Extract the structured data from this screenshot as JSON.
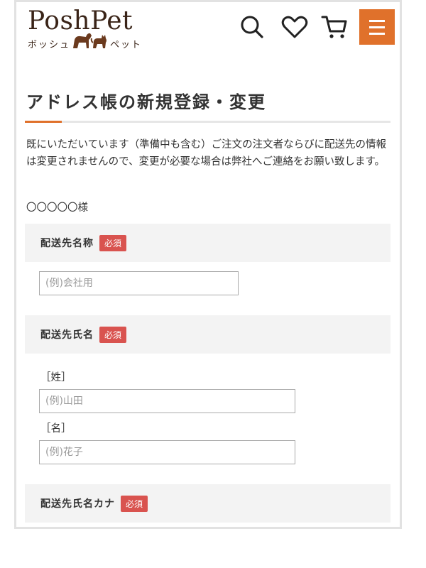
{
  "header": {
    "logo_main": "PoshPet",
    "logo_sub_left": "ボッシュ",
    "logo_sub_right": "ペット",
    "icons": [
      "search-icon",
      "heart-icon",
      "cart-icon",
      "hamburger-menu-icon"
    ],
    "accent_color": "#e0712b"
  },
  "page": {
    "title": "アドレス帳の新規登録・変更",
    "notice": "既にいただいています（準備中も含む）ご注文の注文者ならびに配送先の情報は変更されませんので、変更が必要な場合は弊社へご連絡をお願い致します。",
    "customer": "〇〇〇〇〇様"
  },
  "form": {
    "required_label": "必須",
    "sections": [
      {
        "label": "配送先名称",
        "placeholder": "(例)会社用"
      },
      {
        "label": "配送先氏名",
        "last_label": "［姓］",
        "last_placeholder": "(例)山田",
        "first_label": "［名］",
        "first_placeholder": "(例)花子"
      },
      {
        "label": "配送先氏名カナ"
      }
    ]
  }
}
